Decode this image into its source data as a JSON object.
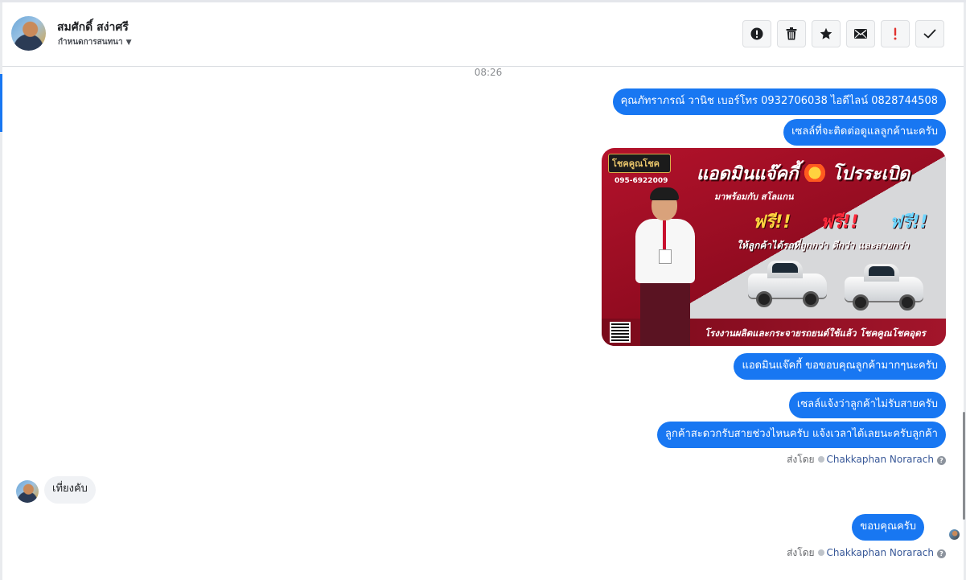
{
  "header": {
    "contact_name": "สมศักดิ์ สง่าศรี",
    "contact_status": "กำหนดการสนทนา",
    "tools": [
      {
        "name": "alert-icon",
        "label": "!"
      },
      {
        "name": "trash-icon",
        "label": ""
      },
      {
        "name": "star-icon",
        "label": ""
      },
      {
        "name": "envelope-icon",
        "label": ""
      },
      {
        "name": "exclamation-icon",
        "label": "!"
      },
      {
        "name": "checkmark-icon",
        "label": ""
      }
    ]
  },
  "conversation": {
    "timestamp": "08:26",
    "messages_out_1": [
      "คุณภัทราภรณ์  วานิช      เบอร์โทร 0932706038  ไอดีไลน์ 0828744508",
      "เซลล์ที่จะติดต่อดูแลลูกค้านะครับ"
    ],
    "promo": {
      "logo": "โชคคูณโชค",
      "phone": "095-6922009",
      "headline_left": "แอดมินแจ๊คกี้",
      "headline_right": "โปรระเบิด",
      "sub": "มาพร้อมกับ สโลแกน",
      "free": [
        "ฟรี!!",
        "ฟรี!!",
        "ฟรี!!"
      ],
      "tagline": "ให้ลูกค้าได้รถที่ถูกกว่า ดีกว่า และสวยกว่า",
      "footer": "โรงงานผลิตและกระจายรถยนต์ใช้แล้ว โชคคูณโชคอุดร"
    },
    "messages_out_2": [
      "แอดมินแจ๊คกี้ ขอขอบคุณลูกค้ามากๆนะครับ",
      "เซลล์แจ้งว่าลูกค้าไม่รับสายครับ",
      "ลูกค้าสะดวกรับสายช่วงไหนครับ แจ้งเวลาได้เลยนะครับลูกค้า"
    ],
    "sent_by_label": "ส่งโดย",
    "agent_name": "Chakkaphan Norarach",
    "incoming_message": "เที่ยงคับ",
    "final_message": "ขอบคุณครับ"
  },
  "colors": {
    "outgoing_bubble": "#1877f2",
    "incoming_bubble": "#f0f2f5",
    "agent_link": "#385898"
  }
}
